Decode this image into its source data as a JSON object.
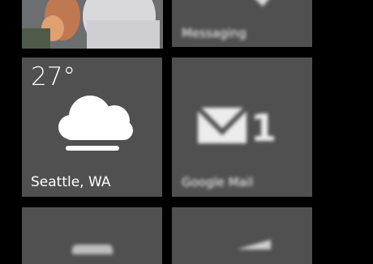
{
  "tiles": {
    "photo": {
      "icon": "person-photo"
    },
    "messaging": {
      "label": "Messaging",
      "icon": "speech-bubble-icon"
    },
    "weather": {
      "temperature": "27°",
      "location": "Seattle, WA",
      "icon": "cloud-icon"
    },
    "mail": {
      "label": "Google Mail",
      "count": "1",
      "icon": "envelope-icon"
    },
    "bottom_left": {
      "icon": "unknown"
    },
    "bottom_right": {
      "icon": "unknown"
    }
  },
  "colors": {
    "tile": "#505050",
    "background": "#000000",
    "text": "#ffffff"
  }
}
